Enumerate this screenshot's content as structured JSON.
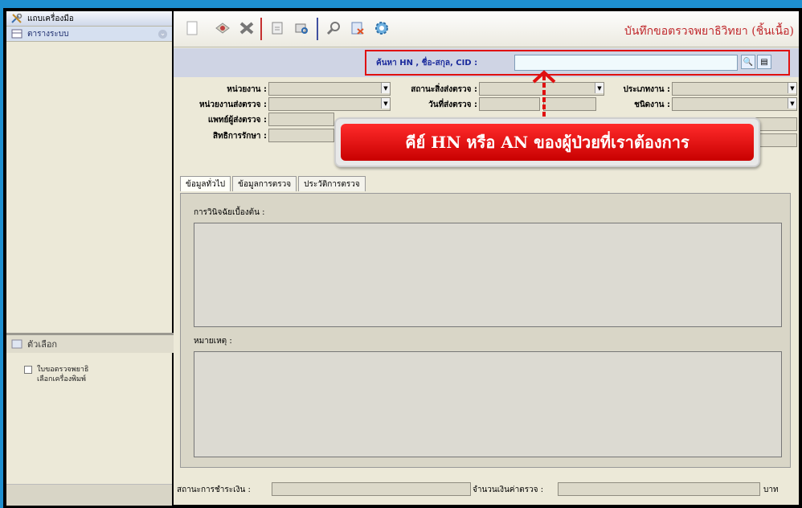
{
  "sidebar": {
    "toolbox_label": "แถบเครื่องมือ",
    "system_table_label": "ตารางระบบ",
    "options_label": "ตัวเลือก",
    "option_items": [
      "ใบขอตรวจพยาธิ",
      "เลือกเครื่องพิมพ์"
    ]
  },
  "toolbar": {
    "title": "บันทึกขอตรวจพยาธิวิทยา (ชิ้นเนื้อ)",
    "icons": [
      "new-icon",
      "save-icon",
      "delete-icon",
      "print-icon",
      "print-preview-icon",
      "search-icon",
      "export-icon",
      "settings-icon"
    ]
  },
  "search": {
    "label": "ค้นหา HN , ชื่อ-สกุล, CID :",
    "value": ""
  },
  "form": {
    "unit_label": "หน่วยงาน :",
    "sending_unit_label": "หน่วยงานส่งตรวจ :",
    "doctor_label": "แพทย์ผู้ส่งตรวจ :",
    "rights_label": "สิทธิการรักษา :",
    "place_label": "สถานะสิ่งส่งตรวจ :",
    "send_date_label": "วันที่ส่งตรวจ :",
    "work_type_label": "ประเภทงาน :",
    "job_type_label": "ชนิดงาน :"
  },
  "callout": {
    "text": "คีย์ HN หรือ AN ของผู้ป่วยที่เราต้องการ"
  },
  "tabs": [
    "ข้อมูลทั่วไป",
    "ข้อมูลการตรวจ",
    "ประวัติการตรวจ"
  ],
  "panel": {
    "diagnosis_label": "การวินิจฉัยเบื้องต้น :",
    "note_label": "หมายเหตุ :"
  },
  "footer": {
    "payment_status_label": "สถานะการชำระเงิน :",
    "amount_label": "จำนวนเงินค่าตรวจ :",
    "currency_label": "บาท"
  },
  "colors": {
    "accent_red": "#e01010",
    "title_red": "#c0282c",
    "label_blue": "#1a2a9c",
    "background_blue": "#1e8fd0"
  }
}
